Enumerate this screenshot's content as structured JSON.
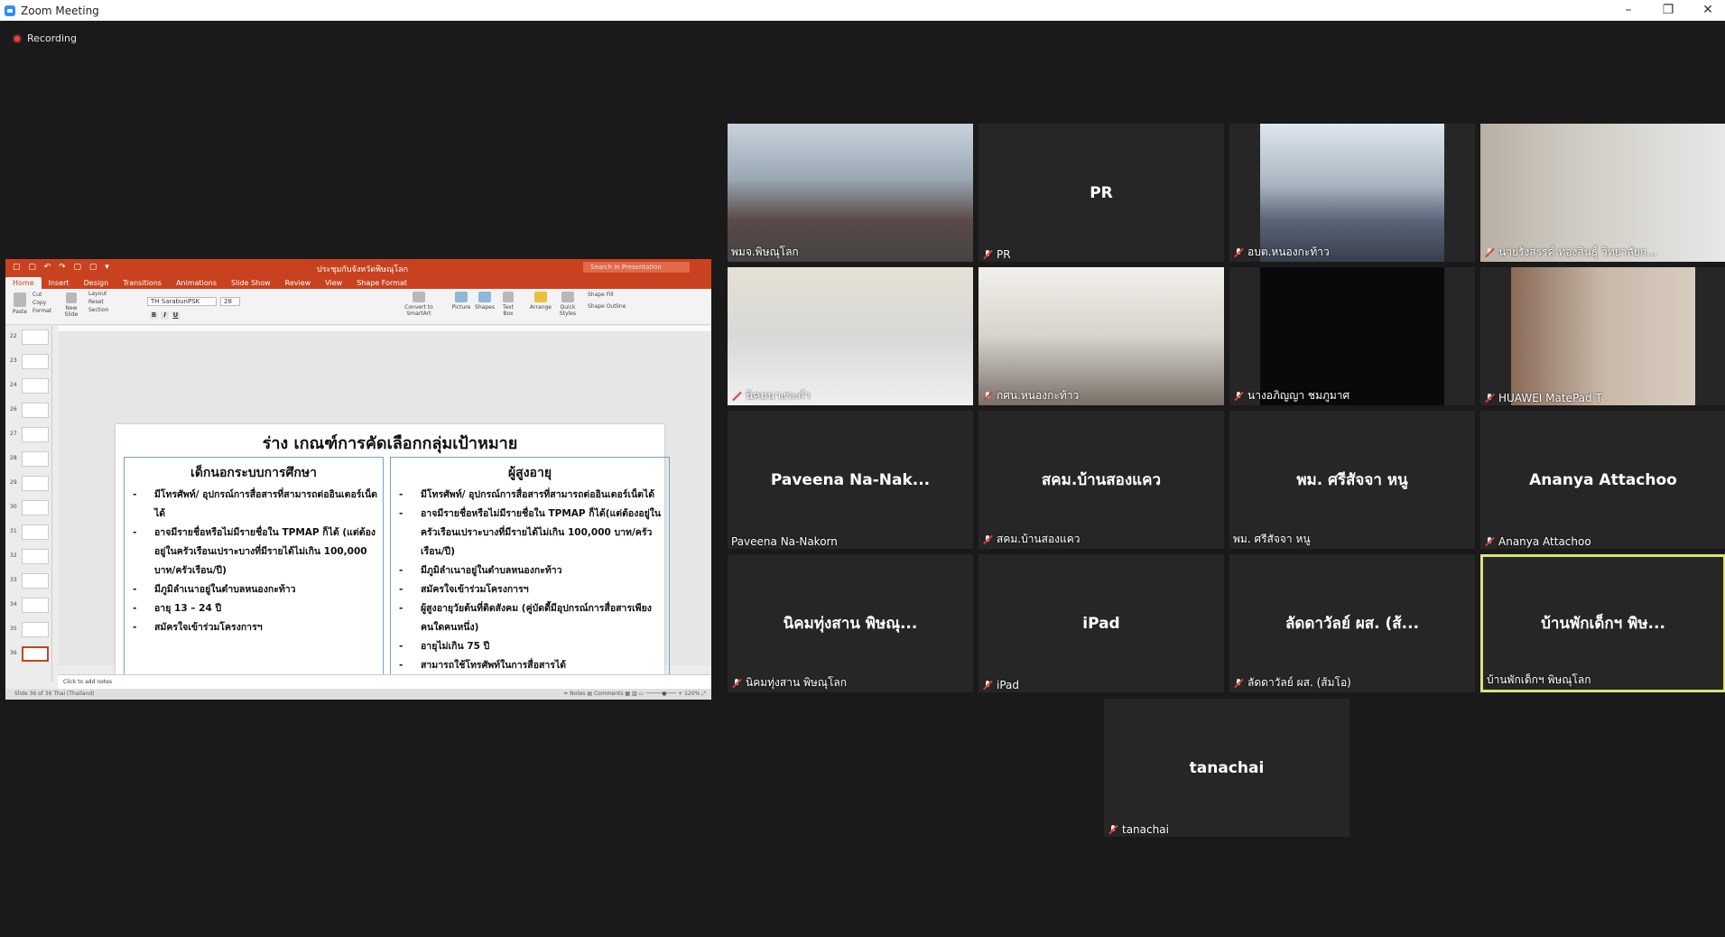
{
  "window": {
    "title": "Zoom Meeting",
    "minimize": "–",
    "restore": "❐",
    "close": "✕"
  },
  "recording": {
    "label": "Recording"
  },
  "ppt": {
    "quick_access": "▢ ▢ ↶ ↷ ▢ ▢ ▾",
    "doc_title": "ประชุมกับจังหวัดพิษณุโลก",
    "search_placeholder": "Search in Presentation",
    "tabs": [
      "Home",
      "Insert",
      "Design",
      "Transitions",
      "Animations",
      "Slide Show",
      "Review",
      "View",
      "Shape Format"
    ],
    "ribbon": {
      "paste": "Paste",
      "cut": "Cut",
      "copy": "Copy",
      "format": "Format",
      "new_slide": "New Slide",
      "layout": "Layout",
      "reset": "Reset",
      "section": "Section",
      "font": "TH SarabunPSK",
      "size": "28",
      "bold": "B",
      "italic": "I",
      "underline": "U",
      "convert": "Convert to SmartArt",
      "picture": "Picture",
      "shapes": "Shapes",
      "textbox": "Text Box",
      "arrange": "Arrange",
      "quick_styles": "Quick Styles",
      "shape_fill": "Shape Fill",
      "shape_outline": "Shape Outline"
    },
    "thumbs": [
      "22",
      "23",
      "24",
      "26",
      "27",
      "28",
      "29",
      "30",
      "31",
      "32",
      "33",
      "34",
      "35",
      "36"
    ],
    "slide": {
      "title": "ร่าง เกณฑ์การคัดเลือกกลุ่มเป้าหมาย",
      "left_heading": "เด็กนอกระบบการศึกษา",
      "left_items": [
        "มีโทรศัพท์/ อุปกรณ์การสื่อสารที่สามารถต่ออินเตอร์เน็ตได้",
        "อาจมีรายชื่อหรือไม่มีรายชื่อใน TPMAP ก็ได้ (แต่ต้องอยู่ในครัวเรือนเปราะบางที่มีรายได้ไม่เกิน 100,000 บาท/ครัวเรือน/ปี)",
        "มีภูมิลำเนาอยู่ในตำบลหนองกะท้าว",
        "อายุ 13 – 24 ปี",
        "สมัครใจเข้าร่วมโครงการฯ"
      ],
      "right_heading": "ผู้สูงอายุ",
      "right_items": [
        "มีโทรศัพท์/ อุปกรณ์การสื่อสารที่สามารถต่ออินเตอร์เน็ตได้",
        "อาจมีรายชื่อหรือไม่มีรายชื่อใน TPMAP ก็ได้(แต่ต้องอยู่ในครัวเรือนเปราะบางที่มีรายได้ไม่เกิน 100,000 บาท/ครัวเรือน/ปี)",
        "มีภูมิลำเนาอยู่ในตำบลหนองกะท้าว",
        "สมัครใจเข้าร่วมโครงการฯ",
        "ผู้สูงอายุวัยต้นที่ติดสังคม (คู่บัดดี้มีอุปกรณ์การสื่อสารเพียงคนใดคนหนึ่ง)",
        "อายุไม่เกิน 75 ปี",
        "สามารถใช้โทรศัพท์ในการสื่อสารได้"
      ]
    },
    "notes_placeholder": "Click to add notes",
    "status_left": "Slide 36 of 36     Thai (Thailand)",
    "status_right": "≐ Notes   ▤ Comments   ▦  ▥  ▭   ─────●─── +  120%  ⤢"
  },
  "participants": [
    {
      "center": "",
      "label": "พมจ.พิษณุโลก",
      "muted": false
    },
    {
      "center": "PR",
      "label": "PR",
      "muted": true
    },
    {
      "center": "",
      "label": "อบต.หนองกะท้าว",
      "muted": true
    },
    {
      "center": "",
      "label": "นายรังสรรค์ ทองสินธุ์ วิทยาลัยก...",
      "muted": true
    },
    {
      "center": "",
      "label": "นิคมนางระกำ",
      "muted": true
    },
    {
      "center": "",
      "label": "กศน.หนองกะท้าว",
      "muted": true
    },
    {
      "center": "",
      "label": "นางอภิญญา ชมภูมาศ",
      "muted": true
    },
    {
      "center": "",
      "label": "HUAWEI MatePad T",
      "muted": true
    },
    {
      "center": "Paveena  Na-Nak...",
      "label": "Paveena Na-Nakorn",
      "muted": false
    },
    {
      "center": "สคม.บ้านสองแคว",
      "label": "สคม.บ้านสองแคว",
      "muted": true
    },
    {
      "center": "พม. ศรีสัจจา หนู",
      "label": "พม. ศรีสัจจา หนู",
      "muted": false
    },
    {
      "center": "Ananya  Attachoo",
      "label": "Ananya  Attachoo",
      "muted": true
    },
    {
      "center": "นิคมทุ่งสาน พิษณุ...",
      "label": "นิคมทุ่งสาน พิษณุโลก",
      "muted": true
    },
    {
      "center": "iPad",
      "label": "iPad",
      "muted": true
    },
    {
      "center": "ลัดดาวัลย์  ผส. (ส้...",
      "label": "ลัดดาวัลย์  ผส. (ส้มโอ)",
      "muted": true
    },
    {
      "center": "บ้านพักเด็กฯ พิษ...",
      "label": "บ้านพักเด็กฯ พิษณุโลก",
      "muted": false
    },
    {
      "center": "tanachai",
      "label": "tanachai",
      "muted": true
    }
  ]
}
